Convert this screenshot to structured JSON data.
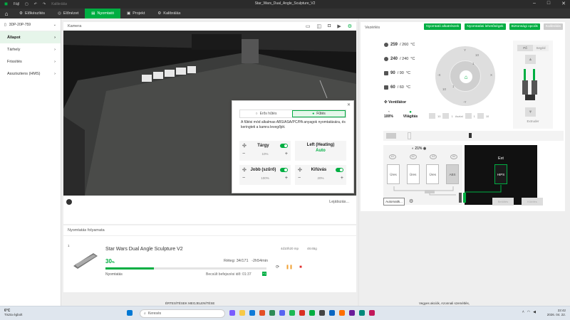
{
  "window": {
    "title": "Star_Wars_Dual_Angle_Sculpture_V2",
    "menu_label": "Fájl",
    "calibration_hint": "Kalibrálás",
    "controls": [
      "–",
      "□",
      "✕"
    ]
  },
  "nav": {
    "tabs": [
      {
        "label": "Előkészítés",
        "icon": "prepare-icon"
      },
      {
        "label": "Előnézet",
        "icon": "preview-icon"
      },
      {
        "label": "Nyomtató",
        "icon": "printer-icon",
        "active": true
      },
      {
        "label": "Projekt",
        "icon": "project-icon"
      },
      {
        "label": "Kalibrálás",
        "icon": "calibration-icon"
      }
    ]
  },
  "sidebar": {
    "printer": "3DP-20P-759",
    "items": [
      {
        "label": "Állapot",
        "active": true
      },
      {
        "label": "Tárhely"
      },
      {
        "label": "Frissítés"
      },
      {
        "label": "Asszisztens (HMS)"
      }
    ]
  },
  "camera": {
    "title": "Kamera",
    "play_label": "Lejátszás...",
    "popup": {
      "mode_off": "Erős hűtés",
      "mode_on": "Fűtés",
      "description": "A fűtési mód alkalmas ABS/ASA/PC/PA anyagok nyomtatására, és keringteti a kamra levegőjét.",
      "cells": {
        "part": {
          "label": "Tárgy",
          "value": "10%"
        },
        "left": {
          "label": "Left (Heating)",
          "state": "Auto"
        },
        "right": {
          "label": "Jobb (szűrő)",
          "value": "100%"
        },
        "exhaust": {
          "label": "Kifúvás",
          "value": "20%"
        }
      }
    }
  },
  "progress": {
    "title": "Nyomtatás folyamata",
    "index": "1",
    "job_name": "Star Wars Dual Angle Sculpture V2",
    "total_time": "4d10h20 mp",
    "weight": "48.65g",
    "percent": "30",
    "percent_unit": "%",
    "percent_value": 0.3,
    "layer": "Réteg: 34/171",
    "remaining": "-2h54min",
    "status": "Nyomtatás",
    "eta": "Becsült befejezési idő: 01:37",
    "eta_badge": "+1"
  },
  "control": {
    "title": "Vezérlés",
    "buttons": [
      "Nyomtató alkatrészek",
      "Nyomtatási lehetőségek",
      "Biztonsági opciók",
      "Kalibrálás"
    ],
    "temps": [
      {
        "value": "259",
        "target": "/ 260",
        "unit": "°C"
      },
      {
        "value": "240",
        "target": "/ 240",
        "unit": "°C"
      },
      {
        "value": "90",
        "target": "/ 90",
        "unit": "°C"
      },
      {
        "value": "60",
        "target": "/ 60",
        "unit": "°C"
      }
    ],
    "fan_label": "Ventilátor",
    "fan_pct": "100%",
    "light_label": "Világítás",
    "jog_labels": [
      "Y",
      "X",
      "-Y",
      "-X",
      "10",
      "10",
      "1",
      "1"
    ],
    "bed_labels": [
      "10",
      "1",
      "Asztal",
      "1",
      "10"
    ],
    "extruder": {
      "tab_left": "Fő",
      "tab_right": "Segéd",
      "label": "Extruder"
    },
    "ams": {
      "humidity": "21",
      "humidity_unit": "%",
      "slot_ids": [
        "A1",
        "A2",
        "A3",
        "A4"
      ],
      "slots": [
        "Üres",
        "Üres",
        "Üres",
        "ABS"
      ],
      "ext_title": "Ext",
      "ext_spool": "HIPS",
      "auto_label": "Automatik...",
      "load_label": "Betöltés",
      "unload_label": "Kiürítés"
    }
  },
  "taskbar": {
    "weather_temp": "6°C",
    "weather_desc": "Tiszta égbolt",
    "search": "Keresés",
    "time": "22:42",
    "date": "2026. 04. 22."
  },
  "background_text": [
    "ÉRTESÍTÉSEK MEGJELENÍTÉSE",
    "Vegyes akciók, Azonnali szemétlés,"
  ]
}
